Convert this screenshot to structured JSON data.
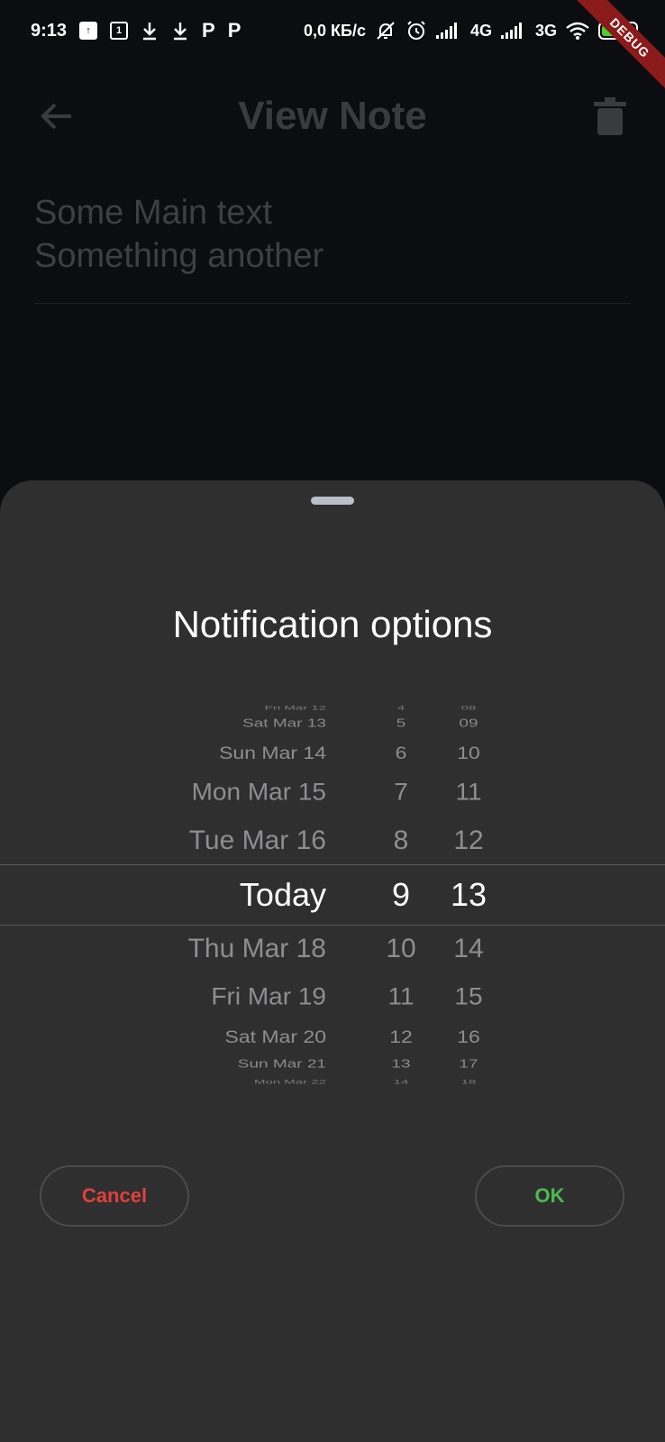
{
  "status_bar": {
    "time": "9:13",
    "network_speed": "0,0 КБ/с",
    "signal_1": "4G",
    "signal_2": "3G",
    "battery": "97",
    "debug_label": "DEBUG"
  },
  "app_bar": {
    "title": "View Note"
  },
  "note": {
    "line1": "Some Main text",
    "line2": "Something another"
  },
  "sheet": {
    "title": "Notification options",
    "cancel_label": "Cancel",
    "ok_label": "OK"
  },
  "picker": {
    "rows": [
      {
        "day": "Fri Mar 12",
        "hour": "4",
        "min": "08"
      },
      {
        "day": "Sat Mar 13",
        "hour": "5",
        "min": "09"
      },
      {
        "day": "Sun Mar 14",
        "hour": "6",
        "min": "10"
      },
      {
        "day": "Mon Mar 15",
        "hour": "7",
        "min": "11"
      },
      {
        "day": "Tue Mar 16",
        "hour": "8",
        "min": "12"
      },
      {
        "day": "Today",
        "hour": "9",
        "min": "13"
      },
      {
        "day": "Thu Mar 18",
        "hour": "10",
        "min": "14"
      },
      {
        "day": "Fri Mar 19",
        "hour": "11",
        "min": "15"
      },
      {
        "day": "Sat Mar 20",
        "hour": "12",
        "min": "16"
      },
      {
        "day": "Sun Mar 21",
        "hour": "13",
        "min": "17"
      },
      {
        "day": "Mon Mar 22",
        "hour": "14",
        "min": "18"
      }
    ]
  },
  "colors": {
    "sheet_bg": "#2f2f30",
    "cancel": "#e0413a",
    "ok": "#4cba50"
  }
}
